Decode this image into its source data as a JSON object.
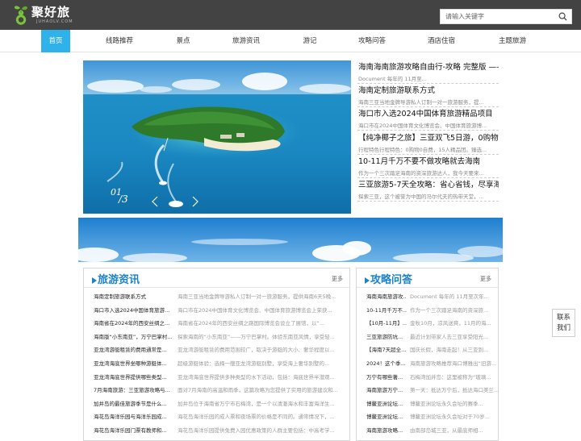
{
  "brand": {
    "name": "聚好旅",
    "domain_text": "JUHAOLV.COM",
    "accent_color": "#2fb1e9",
    "logo_icon": "gourd-leaf-icon"
  },
  "search": {
    "placeholder": "请输入关键字",
    "icon": "search-icon"
  },
  "nav": {
    "items": [
      {
        "label": "首页",
        "active": true
      },
      {
        "label": "线路推荐",
        "active": false
      },
      {
        "label": "景点",
        "active": false
      },
      {
        "label": "旅游资讯",
        "active": false
      },
      {
        "label": "游记",
        "active": false
      },
      {
        "label": "攻略问答",
        "active": false
      },
      {
        "label": "酒店住宿",
        "active": false
      },
      {
        "label": "主题旅游",
        "active": false
      }
    ]
  },
  "slider": {
    "current": "01",
    "total": "/3"
  },
  "headlines": [
    {
      "title": "海南海南旅游攻略自由行-攻略 完整版 ——",
      "desc": "Document 每年的 11月至..."
    },
    {
      "title": "海南定制旅游联系方式",
      "desc": "海南三亚当地金牌导游私人订制一对一旅游服务，提..."
    },
    {
      "title": "海口市入选2024中国体育旅游精品项目",
      "desc": "海口市在2024中国体育文化博览会、中国体育旅游博..."
    },
    {
      "title": "【纯净椰子之旅】三亚双飞5日游，0购物0",
      "desc": "行程特色行程特色：0购物0自费，15人精品团。臻选..."
    },
    {
      "title": "10-11月千万不要不做攻略就去海南",
      "desc": "作为一个三次踏足海南的资深旅游达人，我今天要来..."
    },
    {
      "title": "三亚旅游5-7天全攻略：省心省钱，尽享海",
      "desc": "探索三亚，这个被誉为中国的马尔代夫的热带天堂，..."
    }
  ],
  "news_panel": {
    "title": "旅游资讯",
    "more": "更多",
    "rows": [
      {
        "title": "海南定制旅游联系方式",
        "desc": "海南三亚当地金牌导游私人订制一对一旅游服务，提供海南6天5晚..."
      },
      {
        "title": "海口市入选2024中国体育旅游...",
        "desc": "海口市在2024中国体育文化博览会、中国体育旅游博览会上荣获..."
      },
      {
        "title": "海南省在2024年的西安丝绸之...",
        "desc": "海南省在2024年的西安丝绸之路国际博览会设立了展馆，以“..."
      },
      {
        "title": "海南版“小东南亚”，万宁巴掌村...",
        "desc": "探索海南的“小东南亚”——万宁巴掌村。体验东南亚风情，享受轻..."
      },
      {
        "title": "亚龙湾游艇租赁的费用通常是...",
        "desc": "亚龙湾游艇租赁的费用范围较广，取决于游艇的大小、奢华程度以..."
      },
      {
        "title": "亚龙湾海底世界坐哪种游艇体...",
        "desc": "超级游艇体验：选择一艘亚龙湾游艇别墅，享受海上奢华别墅的..."
      },
      {
        "title": "亚龙湾海底世界提供哪些类型...",
        "desc": "亚龙湾海底世界提供多种类型的水下活动，包括：海底世界半潜观..."
      },
      {
        "title": "7月海南旅游：三亚旅游攻略与...",
        "desc": "面对7月海南的高温和雨季，这篇攻略为您提供了实用的旅游建议和..."
      },
      {
        "title": "加井岛的最佳旅游季节是什么...",
        "desc": "加井岛位于海南省万宁市石梅湾，是一个以清澈海水和丰富海洋生..."
      },
      {
        "title": "海花岛海洋乐园与海洋乐园成...",
        "desc": "海花岛海洋乐园的成人票和夜场票的价格是不同的。通常情况下，..."
      },
      {
        "title": "海花岛海洋乐园门票有教师和...",
        "desc": "海花岛海洋乐园提供免费入园优惠政策的人群主要包括：中高考学..."
      }
    ]
  },
  "qa_panel": {
    "title": "攻略问答",
    "more": "更多",
    "rows": [
      {
        "title": "海南海南旅游攻...",
        "desc": "Document 每年的 11月至次年..."
      },
      {
        "title": "10-11月千万不...",
        "desc": "作为一个三次踏足海南的资深旅..."
      },
      {
        "title": "【10月-11月】...",
        "desc": "金秋10月，凉风送爽，11月的海..."
      },
      {
        "title": "三亚旅游防坑...",
        "desc": "最近计划带家人去三亚享受阳光..."
      },
      {
        "title": "【海南7天超全...",
        "desc": "国庆长假，海南走起！从三亚到..."
      },
      {
        "title": "2024！这个季...",
        "desc": "海南旅游攻略推荐海口博雅出“旧游..."
      },
      {
        "title": "万宁有哪些著...",
        "desc": "石梅湾加井岛：这里被称为“玻璃..."
      },
      {
        "title": "海南旅游万宁...",
        "desc": "第一天：抵达万宁后，抵达海口美兰..."
      },
      {
        "title": "博鳌亚洲论坛...",
        "desc": "博鳌亚洲论坛永久会址的赛季..."
      },
      {
        "title": "博鳌亚洲论坛...",
        "desc": "博鳌亚洲论坛永久会址对于70岁..."
      },
      {
        "title": "海南旅游攻略...",
        "desc": "由南部岛城三亚，从最底师相..."
      }
    ]
  },
  "contact": {
    "label_line1": "联系",
    "label_line2": "我们"
  }
}
